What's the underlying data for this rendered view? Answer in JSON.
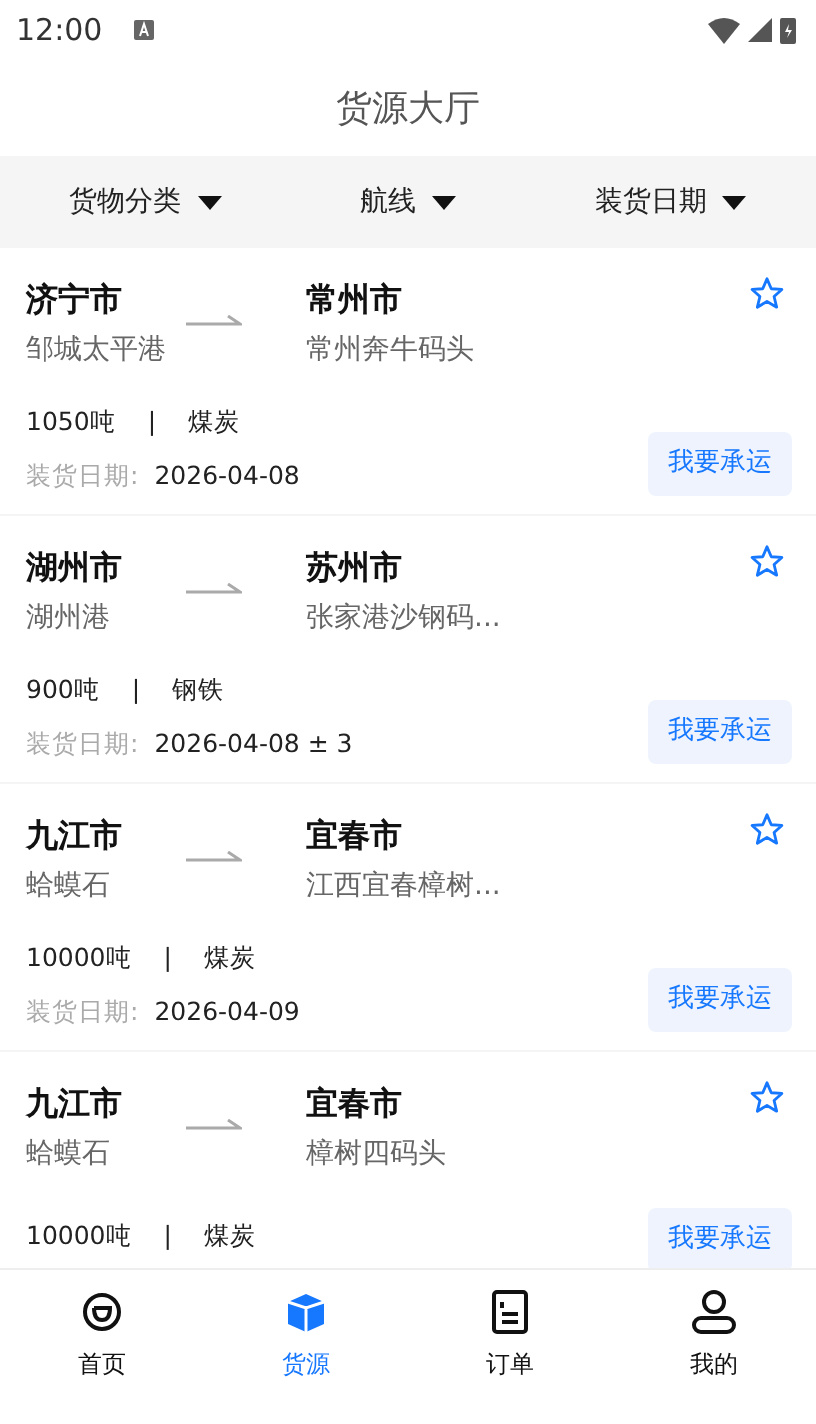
{
  "status_bar": {
    "time": "12:00"
  },
  "title": "货源大厅",
  "filters": [
    {
      "label": "货物分类"
    },
    {
      "label": "航线"
    },
    {
      "label": "装货日期"
    }
  ],
  "cargo_list": [
    {
      "origin_city": "济宁市",
      "origin_port": "邹城太平港",
      "dest_city": "常州市",
      "dest_port": "常州奔牛码头",
      "quantity": "1050吨",
      "separator": "|",
      "cargo": "煤炭",
      "date_label": "装货日期:",
      "date": "2026-04-08",
      "favorited": false,
      "action": "我要承运"
    },
    {
      "origin_city": "湖州市",
      "origin_port": "湖州港",
      "dest_city": "苏州市",
      "dest_port": "张家港沙钢码...",
      "quantity": "900吨",
      "separator": "|",
      "cargo": "钢铁",
      "date_label": "装货日期:",
      "date": "2026-04-08 ± 3",
      "favorited": false,
      "action": "我要承运"
    },
    {
      "origin_city": "九江市",
      "origin_port": "蛤蟆石",
      "dest_city": "宜春市",
      "dest_port": "江西宜春樟树...",
      "quantity": "10000吨",
      "separator": "|",
      "cargo": "煤炭",
      "date_label": "装货日期:",
      "date": "2026-04-09",
      "favorited": false,
      "action": "我要承运"
    },
    {
      "origin_city": "九江市",
      "origin_port": "蛤蟆石",
      "dest_city": "宜春市",
      "dest_port": "樟树四码头",
      "quantity": "10000吨",
      "separator": "|",
      "cargo": "煤炭",
      "favorited": false,
      "action": "我要承运"
    }
  ],
  "tab_bar": [
    {
      "kind": "home",
      "label": "首页",
      "selected": false
    },
    {
      "kind": "cargo",
      "label": "货源",
      "selected": true
    },
    {
      "kind": "orders",
      "label": "订单",
      "selected": false
    },
    {
      "kind": "profile",
      "label": "我的",
      "selected": false
    }
  ]
}
